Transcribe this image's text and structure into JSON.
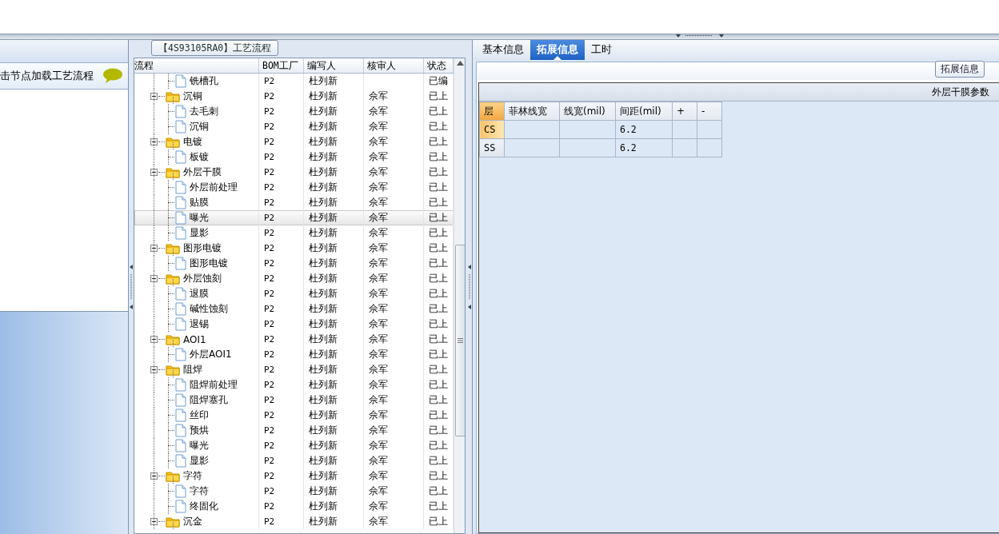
{
  "left_panel": {
    "hint": "击节点加载工艺流程"
  },
  "process_panel": {
    "title": "【4S93105RA0】工艺流程",
    "columns": [
      "流程",
      "BOM工厂",
      "编写人",
      "核审人",
      "状态"
    ],
    "tree": [
      {
        "kind": "file",
        "label": "铣槽孔",
        "bom": "P2",
        "author": "杜列新",
        "status": "已编",
        "selected": false
      },
      {
        "kind": "folder",
        "label": "沉铜",
        "bom": "P2",
        "author": "杜列新",
        "reviewer": "佘军",
        "status": "已上",
        "selected": false,
        "expanded": true,
        "children": [
          {
            "kind": "file",
            "label": "去毛刺",
            "bom": "P2",
            "author": "杜列新",
            "reviewer": "佘军",
            "status": "已上",
            "selected": false
          },
          {
            "kind": "file",
            "label": "沉铜",
            "bom": "P2",
            "author": "杜列新",
            "reviewer": "佘军",
            "status": "已上",
            "selected": false
          }
        ]
      },
      {
        "kind": "folder",
        "label": "电镀",
        "bom": "P2",
        "author": "杜列新",
        "reviewer": "佘军",
        "status": "已上",
        "selected": false,
        "expanded": true,
        "children": [
          {
            "kind": "file",
            "label": "板镀",
            "bom": "P2",
            "author": "杜列新",
            "reviewer": "佘军",
            "status": "已上",
            "selected": false
          }
        ]
      },
      {
        "kind": "folder",
        "label": "外层干膜",
        "bom": "P2",
        "author": "杜列新",
        "reviewer": "佘军",
        "status": "已上",
        "selected": false,
        "expanded": true,
        "children": [
          {
            "kind": "file",
            "label": "外层前处理",
            "bom": "P2",
            "author": "杜列新",
            "reviewer": "佘军",
            "status": "已上",
            "selected": false
          },
          {
            "kind": "file",
            "label": "贴膜",
            "bom": "P2",
            "author": "杜列新",
            "reviewer": "佘军",
            "status": "已上",
            "selected": false
          },
          {
            "kind": "file",
            "label": "曝光",
            "bom": "P2",
            "author": "杜列新",
            "reviewer": "佘军",
            "status": "已上",
            "selected": true
          },
          {
            "kind": "file",
            "label": "显影",
            "bom": "P2",
            "author": "杜列新",
            "reviewer": "佘军",
            "status": "已上",
            "selected": false
          }
        ]
      },
      {
        "kind": "folder",
        "label": "图形电镀",
        "bom": "P2",
        "author": "杜列新",
        "reviewer": "佘军",
        "status": "已上",
        "selected": false,
        "expanded": true,
        "children": [
          {
            "kind": "file",
            "label": "图形电镀",
            "bom": "P2",
            "author": "杜列新",
            "reviewer": "佘军",
            "status": "已上",
            "selected": false
          }
        ]
      },
      {
        "kind": "folder",
        "label": "外层蚀刻",
        "bom": "P2",
        "author": "杜列新",
        "reviewer": "佘军",
        "status": "已上",
        "selected": false,
        "expanded": true,
        "children": [
          {
            "kind": "file",
            "label": "退膜",
            "bom": "P2",
            "author": "杜列新",
            "reviewer": "佘军",
            "status": "已上",
            "selected": false
          },
          {
            "kind": "file",
            "label": "碱性蚀刻",
            "bom": "P2",
            "author": "杜列新",
            "reviewer": "佘军",
            "status": "已上",
            "selected": false
          },
          {
            "kind": "file",
            "label": "退锡",
            "bom": "P2",
            "author": "杜列新",
            "reviewer": "佘军",
            "status": "已上",
            "selected": false
          }
        ]
      },
      {
        "kind": "folder",
        "label": "AOI1",
        "bom": "P2",
        "author": "杜列新",
        "reviewer": "佘军",
        "status": "已上",
        "selected": false,
        "expanded": true,
        "children": [
          {
            "kind": "file",
            "label": "外层AOI1",
            "bom": "P2",
            "author": "杜列新",
            "reviewer": "佘军",
            "status": "已上",
            "selected": false
          }
        ]
      },
      {
        "kind": "folder",
        "label": "阻焊",
        "bom": "P2",
        "author": "杜列新",
        "reviewer": "佘军",
        "status": "已上",
        "selected": false,
        "expanded": true,
        "children": [
          {
            "kind": "file",
            "label": "阻焊前处理",
            "bom": "P2",
            "author": "杜列新",
            "reviewer": "佘军",
            "status": "已上",
            "selected": false
          },
          {
            "kind": "file",
            "label": "阻焊塞孔",
            "bom": "P2",
            "author": "杜列新",
            "reviewer": "佘军",
            "status": "已上",
            "selected": false
          },
          {
            "kind": "file",
            "label": "丝印",
            "bom": "P2",
            "author": "杜列新",
            "reviewer": "佘军",
            "status": "已上",
            "selected": false
          },
          {
            "kind": "file",
            "label": "预烘",
            "bom": "P2",
            "author": "杜列新",
            "reviewer": "佘军",
            "status": "已上",
            "selected": false
          },
          {
            "kind": "file",
            "label": "曝光",
            "bom": "P2",
            "author": "杜列新",
            "reviewer": "佘军",
            "status": "已上",
            "selected": false
          },
          {
            "kind": "file",
            "label": "显影",
            "bom": "P2",
            "author": "杜列新",
            "reviewer": "佘军",
            "status": "已上",
            "selected": false
          }
        ]
      },
      {
        "kind": "folder",
        "label": "字符",
        "bom": "P2",
        "author": "杜列新",
        "reviewer": "佘军",
        "status": "已上",
        "selected": false,
        "expanded": true,
        "children": [
          {
            "kind": "file",
            "label": "字符",
            "bom": "P2",
            "author": "杜列新",
            "reviewer": "佘军",
            "status": "已上",
            "selected": false
          },
          {
            "kind": "file",
            "label": "终固化",
            "bom": "P2",
            "author": "杜列新",
            "reviewer": "佘军",
            "status": "已上",
            "selected": false
          }
        ]
      },
      {
        "kind": "folder",
        "label": "沉金",
        "bom": "P2",
        "author": "杜列新",
        "reviewer": "佘军",
        "status": "已上",
        "selected": false,
        "expanded": true
      }
    ]
  },
  "detail_panel": {
    "tabs": [
      {
        "label": "基本信息",
        "selected": false
      },
      {
        "label": "拓展信息",
        "selected": true
      },
      {
        "label": "工时",
        "selected": false
      }
    ],
    "group_title": "拓展信息",
    "table": {
      "title": "外层干膜参数",
      "columns": [
        "层",
        "菲林线宽",
        "线宽(mil)",
        "间距(mil)",
        "+",
        "-"
      ],
      "rows": [
        {
          "layer": "CS",
          "spacing": "6.2",
          "selected": true
        },
        {
          "layer": "SS",
          "spacing": "6.2",
          "selected": false
        }
      ]
    }
  }
}
